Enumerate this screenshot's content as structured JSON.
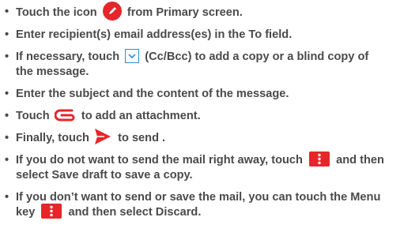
{
  "bullet": "•",
  "colors": {
    "text": "#4a4a4a",
    "accent": "#e5262b",
    "link_blue": "#2e8fd6"
  },
  "items": [
    {
      "before": "Touch the icon",
      "icon": "pen-icon",
      "after": "from Primary screen."
    },
    {
      "text": "Enter recipient(s) email address(es) in the To field."
    },
    {
      "before": "If necessary, touch",
      "icon": "chevron-down-icon",
      "after_line1": "(Cc/Bcc) to add a copy or a blind copy of",
      "line2": "the message."
    },
    {
      "text": "Enter the subject and the content of the message."
    },
    {
      "before": "Touch",
      "icon": "paperclip-icon",
      "after": "to add an attachment."
    },
    {
      "before": "Finally, touch",
      "icon": "send-icon",
      "after": "to send ."
    },
    {
      "line1_before": "If you do not want to send the mail right away, touch",
      "icon": "more-vert-icon",
      "line1_after": "and then",
      "line2": "select Save draft to save a copy."
    },
    {
      "line1": "If you don’t want to send or save the mail, you can touch the Menu",
      "line2_before": "key",
      "icon": "more-vert-icon",
      "line2_after": "and then select Discard."
    }
  ]
}
